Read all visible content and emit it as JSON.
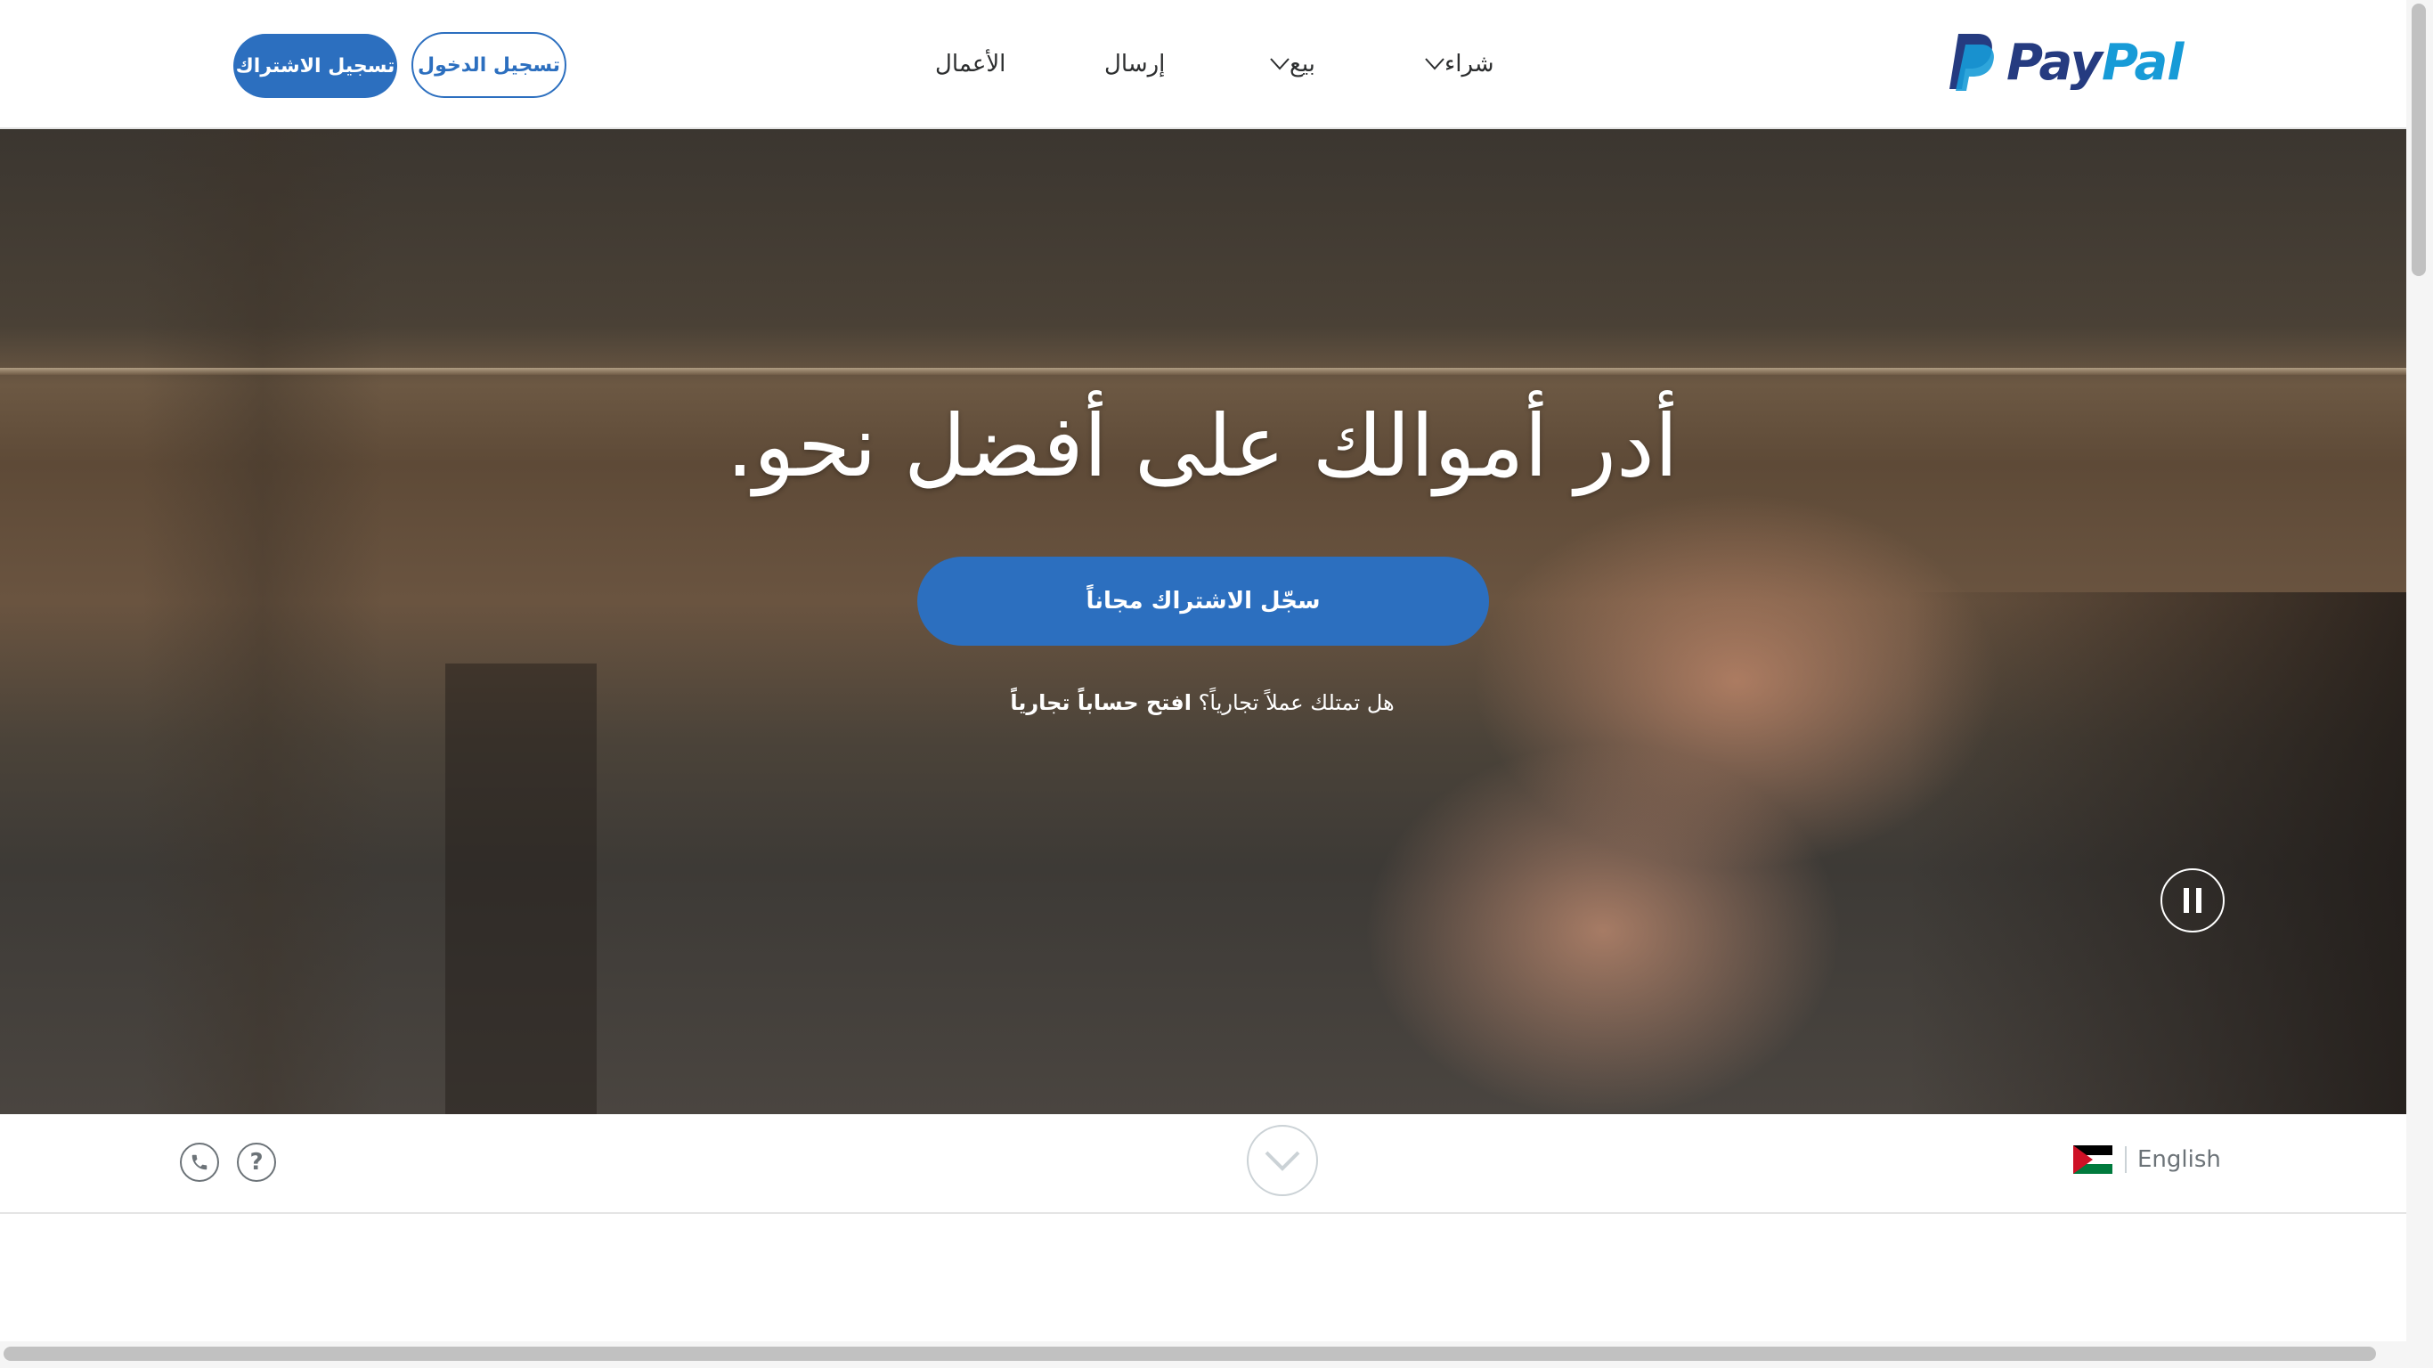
{
  "header": {
    "logo_text_pay": "Pay",
    "logo_text_pal": "Pal",
    "nav": [
      {
        "label": "شراء",
        "has_dropdown": true
      },
      {
        "label": "بيع",
        "has_dropdown": true
      },
      {
        "label": "إرسال",
        "has_dropdown": false
      },
      {
        "label": "الأعمال",
        "has_dropdown": false
      }
    ],
    "signin_label": "تسجيل الدخول",
    "signup_label": "تسجيل الاشتراك"
  },
  "hero": {
    "title": "أدر أموالك على أفضل نحو.",
    "cta_label": "سجّل الاشتراك مجاناً",
    "business_question": "هل تمتلك عملاً تجارياً؟",
    "business_link": "افتح حساباً تجارياً",
    "pause_icon": "pause-icon"
  },
  "footer": {
    "language_label": "English",
    "flag": "jordan-flag-icon",
    "icons": [
      "phone-icon",
      "help-icon",
      "chevron-down-icon"
    ],
    "help_glyph": "?"
  },
  "colors": {
    "brand_dark": "#253b80",
    "brand_light": "#179bd7",
    "button_blue": "#2c6fbf"
  }
}
